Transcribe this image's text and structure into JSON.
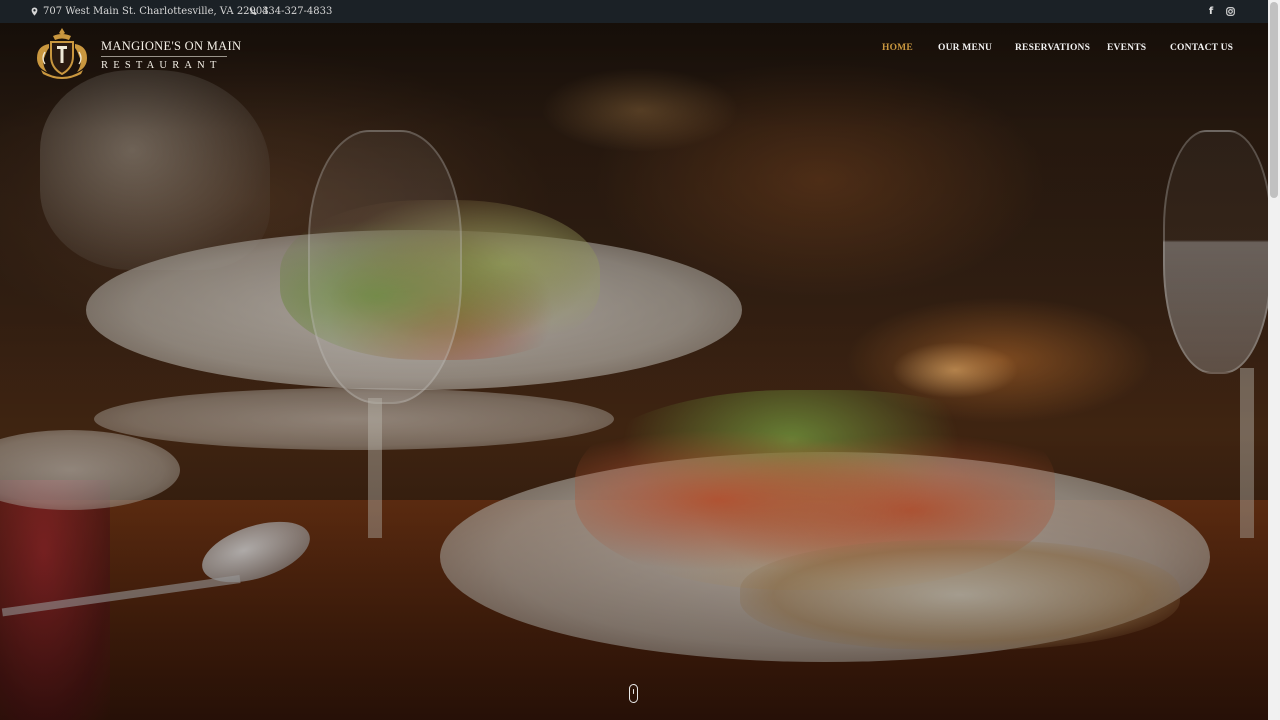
{
  "topbar": {
    "address": "707 West Main St. Charlottesville, VA 22903",
    "phone": "434-327-4833",
    "address_icon": "map-marker-icon",
    "phone_icon": "phone-icon",
    "social": [
      {
        "name": "facebook-icon",
        "glyph": "f"
      },
      {
        "name": "instagram-icon",
        "glyph": "◎"
      }
    ]
  },
  "brand": {
    "name": "MANGIONE'S ON MAIN",
    "subtitle": "RESTAURANT",
    "logo_icon": "crest-logo-icon"
  },
  "nav": {
    "items": [
      {
        "label": "HOME",
        "active": true
      },
      {
        "label": "OUR MENU",
        "active": false
      },
      {
        "label": "RESERVATIONS",
        "active": false
      },
      {
        "label": "EVENTS",
        "active": false
      },
      {
        "label": "CONTACT US",
        "active": false
      }
    ]
  },
  "colors": {
    "topbar_bg": "#1b2126",
    "nav_active": "#c9973f",
    "nav_text": "#f2f2f2",
    "logo_gold": "#c9973f"
  },
  "scroll_indicator_icon": "mouse-scroll-icon"
}
